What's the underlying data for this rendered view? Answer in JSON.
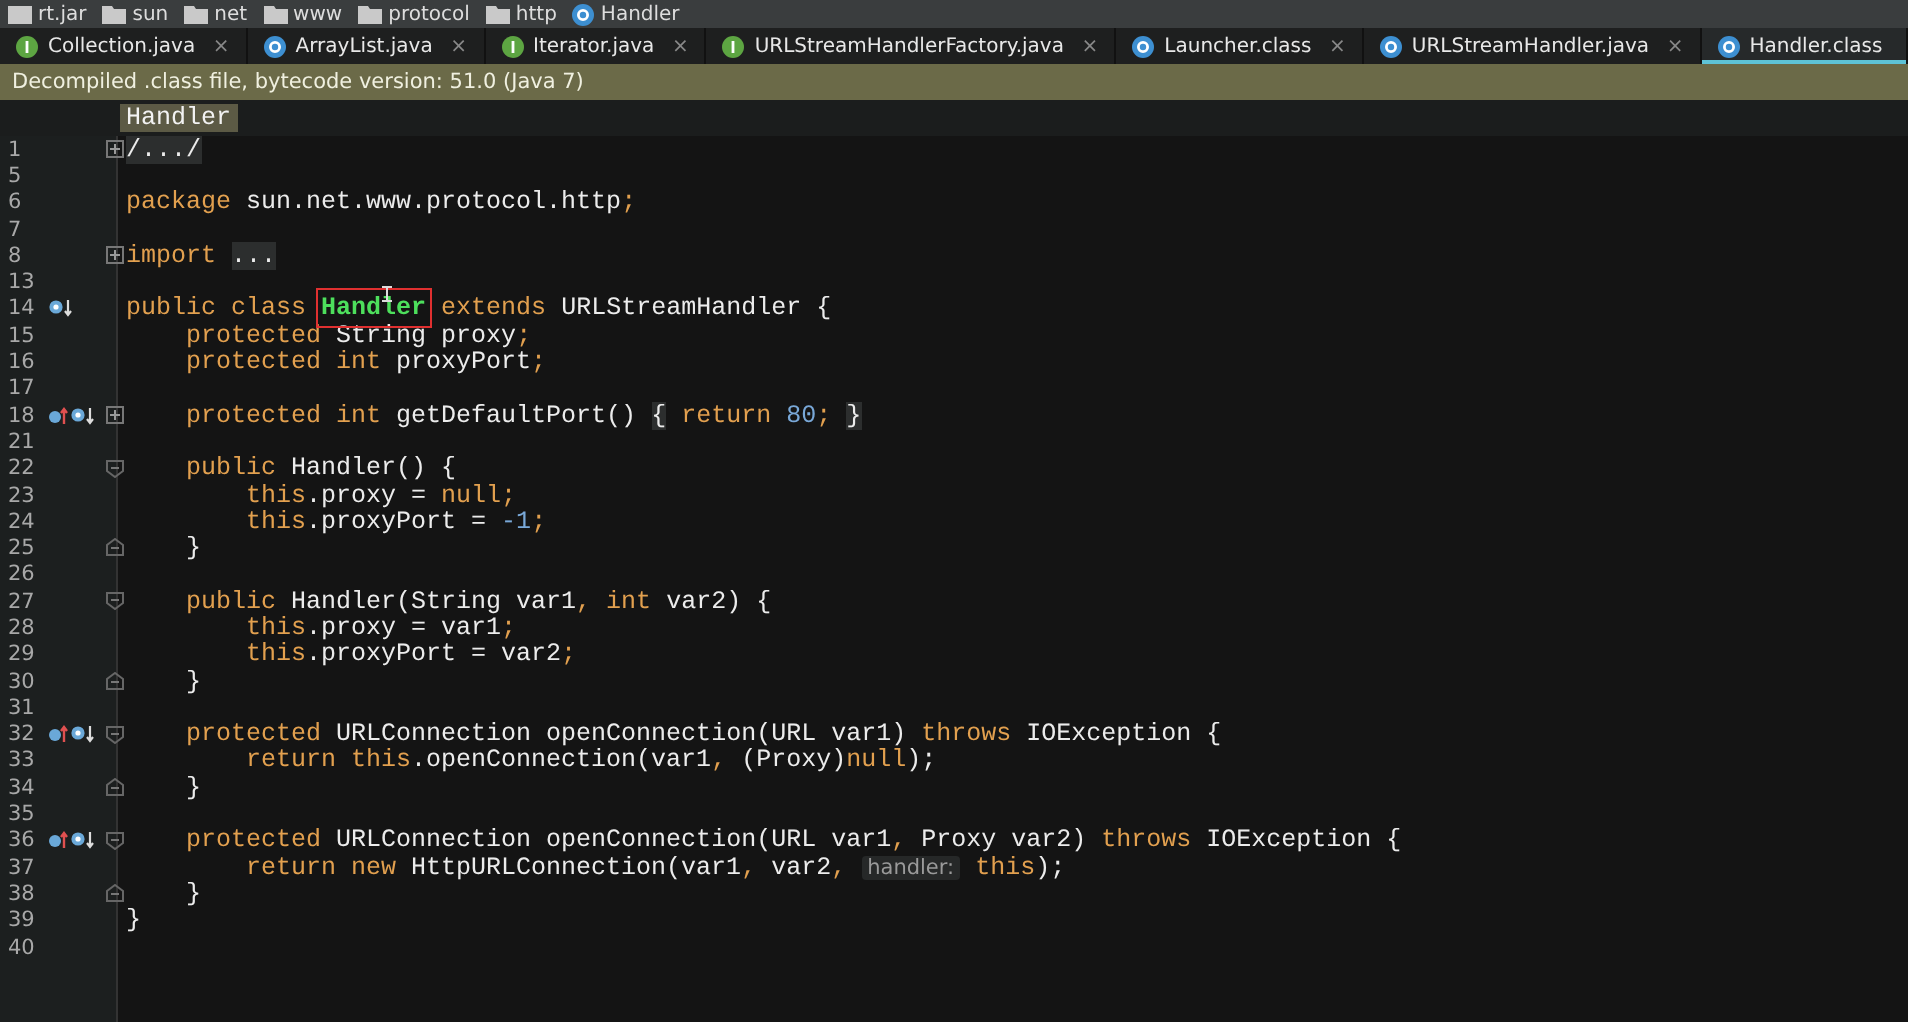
{
  "breadcrumbs": [
    {
      "label": "rt.jar",
      "kind": "jar"
    },
    {
      "label": "sun",
      "kind": "folder"
    },
    {
      "label": "net",
      "kind": "folder"
    },
    {
      "label": "www",
      "kind": "folder"
    },
    {
      "label": "protocol",
      "kind": "folder"
    },
    {
      "label": "http",
      "kind": "folder"
    },
    {
      "label": "Handler",
      "kind": "class"
    }
  ],
  "tabs": [
    {
      "label": "Collection.java",
      "kind": "interface",
      "close": "×",
      "selected": false
    },
    {
      "label": "ArrayList.java",
      "kind": "class",
      "close": "×",
      "selected": false
    },
    {
      "label": "Iterator.java",
      "kind": "interface",
      "close": "×",
      "selected": false
    },
    {
      "label": "URLStreamHandlerFactory.java",
      "kind": "interface",
      "close": "×",
      "selected": false
    },
    {
      "label": "Launcher.class",
      "kind": "class",
      "close": "×",
      "selected": false
    },
    {
      "label": "URLStreamHandler.java",
      "kind": "class",
      "close": "×",
      "selected": false
    },
    {
      "label": "Handler.class",
      "kind": "class",
      "selected": true
    }
  ],
  "banner": "Decompiled .class file, bytecode version: 51.0 (Java 7)",
  "sticky_header": "Handler",
  "lines": [
    {
      "number": "1",
      "fold": {
        "kind": "collapsed"
      },
      "tokens": [
        {
          "kind": "folded",
          "text": "/.../"
        }
      ]
    },
    {
      "number": "5"
    },
    {
      "number": "6",
      "tokens": [
        {
          "kind": "kw",
          "text": "package"
        },
        {
          "kind": "txt",
          "text": " sun.net.www.protocol.http"
        },
        {
          "kind": "kw",
          "text": ";"
        }
      ]
    },
    {
      "number": "7"
    },
    {
      "number": "8",
      "fold": {
        "kind": "collapsed"
      },
      "tokens": [
        {
          "kind": "kw",
          "text": "import "
        },
        {
          "kind": "folded",
          "text": "..."
        }
      ]
    },
    {
      "number": "13"
    },
    {
      "number": "14",
      "gutter": [
        {
          "kind": "implemented"
        }
      ],
      "tokens": [
        {
          "kind": "kw",
          "text": "public class "
        },
        {
          "kind": "highlight",
          "text": "Handler"
        },
        {
          "kind": "kw",
          "text": " extends"
        },
        {
          "kind": "txt",
          "text": " URLStreamHandler {"
        }
      ]
    },
    {
      "number": "15",
      "tokens": [
        {
          "kind": "kw",
          "text": "    protected"
        },
        {
          "kind": "txt",
          "text": " String proxy"
        },
        {
          "kind": "kw",
          "text": ";"
        }
      ]
    },
    {
      "number": "16",
      "tokens": [
        {
          "kind": "kw",
          "text": "    protected int"
        },
        {
          "kind": "txt",
          "text": " proxyPort"
        },
        {
          "kind": "kw",
          "text": ";"
        }
      ]
    },
    {
      "number": "17"
    },
    {
      "number": "18",
      "gutter": [
        {
          "kind": "overrides"
        },
        {
          "kind": "implemented"
        }
      ],
      "fold": {
        "kind": "collapsed"
      },
      "tokens": [
        {
          "kind": "kw",
          "text": "    protected int"
        },
        {
          "kind": "txt",
          "text": " getDefaultPort() "
        },
        {
          "kind": "folded",
          "text": "{"
        },
        {
          "kind": "kw",
          "text": " return "
        },
        {
          "kind": "num",
          "text": "80"
        },
        {
          "kind": "kw",
          "text": "; "
        },
        {
          "kind": "folded",
          "text": "}"
        }
      ]
    },
    {
      "number": "21"
    },
    {
      "number": "22",
      "fold": {
        "kind": "start"
      },
      "tokens": [
        {
          "kind": "kw",
          "text": "    public"
        },
        {
          "kind": "txt",
          "text": " Handler() {"
        }
      ]
    },
    {
      "number": "23",
      "tokens": [
        {
          "kind": "kw",
          "text": "        this"
        },
        {
          "kind": "txt",
          "text": ".proxy = "
        },
        {
          "kind": "kw",
          "text": "null;"
        }
      ]
    },
    {
      "number": "24",
      "tokens": [
        {
          "kind": "kw",
          "text": "        this"
        },
        {
          "kind": "txt",
          "text": ".proxyPort = "
        },
        {
          "kind": "num",
          "text": "-1"
        },
        {
          "kind": "kw",
          "text": ";"
        }
      ]
    },
    {
      "number": "25",
      "fold": {
        "kind": "end"
      },
      "tokens": [
        {
          "kind": "txt",
          "text": "    }"
        }
      ]
    },
    {
      "number": "26"
    },
    {
      "number": "27",
      "fold": {
        "kind": "start"
      },
      "tokens": [
        {
          "kind": "kw",
          "text": "    public"
        },
        {
          "kind": "txt",
          "text": " Handler(String var1"
        },
        {
          "kind": "kw",
          "text": ", int"
        },
        {
          "kind": "txt",
          "text": " var2) {"
        }
      ]
    },
    {
      "number": "28",
      "tokens": [
        {
          "kind": "kw",
          "text": "        this"
        },
        {
          "kind": "txt",
          "text": ".proxy = var1"
        },
        {
          "kind": "kw",
          "text": ";"
        }
      ]
    },
    {
      "number": "29",
      "tokens": [
        {
          "kind": "kw",
          "text": "        this"
        },
        {
          "kind": "txt",
          "text": ".proxyPort = var2"
        },
        {
          "kind": "kw",
          "text": ";"
        }
      ]
    },
    {
      "number": "30",
      "fold": {
        "kind": "end"
      },
      "tokens": [
        {
          "kind": "txt",
          "text": "    }"
        }
      ]
    },
    {
      "number": "31"
    },
    {
      "number": "32",
      "gutter": [
        {
          "kind": "overrides"
        },
        {
          "kind": "implemented"
        }
      ],
      "fold": {
        "kind": "start"
      },
      "tokens": [
        {
          "kind": "kw",
          "text": "    protected"
        },
        {
          "kind": "txt",
          "text": " URLConnection openConnection(URL var1) "
        },
        {
          "kind": "kw",
          "text": "throws"
        },
        {
          "kind": "txt",
          "text": " IOException {"
        }
      ]
    },
    {
      "number": "33",
      "tokens": [
        {
          "kind": "kw",
          "text": "        return this"
        },
        {
          "kind": "txt",
          "text": ".openConnection(var1"
        },
        {
          "kind": "kw",
          "text": ","
        },
        {
          "kind": "txt",
          "text": " (Proxy)"
        },
        {
          "kind": "kw",
          "text": "null"
        },
        {
          "kind": "txt",
          "text": ");"
        }
      ]
    },
    {
      "number": "34",
      "fold": {
        "kind": "end"
      },
      "tokens": [
        {
          "kind": "txt",
          "text": "    }"
        }
      ]
    },
    {
      "number": "35"
    },
    {
      "number": "36",
      "gutter": [
        {
          "kind": "overrides"
        },
        {
          "kind": "implemented"
        }
      ],
      "fold": {
        "kind": "start"
      },
      "tokens": [
        {
          "kind": "kw",
          "text": "    protected"
        },
        {
          "kind": "txt",
          "text": " URLConnection openConnection(URL var1"
        },
        {
          "kind": "kw",
          "text": ","
        },
        {
          "kind": "txt",
          "text": " Proxy var2) "
        },
        {
          "kind": "kw",
          "text": "throws"
        },
        {
          "kind": "txt",
          "text": " IOException {"
        }
      ]
    },
    {
      "number": "37",
      "tokens": [
        {
          "kind": "kw",
          "text": "        return new"
        },
        {
          "kind": "txt",
          "text": " HttpURLConnection(var1"
        },
        {
          "kind": "kw",
          "text": ","
        },
        {
          "kind": "txt",
          "text": " var2"
        },
        {
          "kind": "kw",
          "text": ", "
        },
        {
          "kind": "hint",
          "text": "handler:"
        },
        {
          "kind": "kw",
          "text": " this"
        },
        {
          "kind": "txt",
          "text": ");"
        }
      ]
    },
    {
      "number": "38",
      "fold": {
        "kind": "end"
      },
      "tokens": [
        {
          "kind": "txt",
          "text": "    }"
        }
      ]
    },
    {
      "number": "39",
      "tokens": [
        {
          "kind": "txt",
          "text": "}"
        }
      ]
    },
    {
      "number": "40"
    }
  ]
}
